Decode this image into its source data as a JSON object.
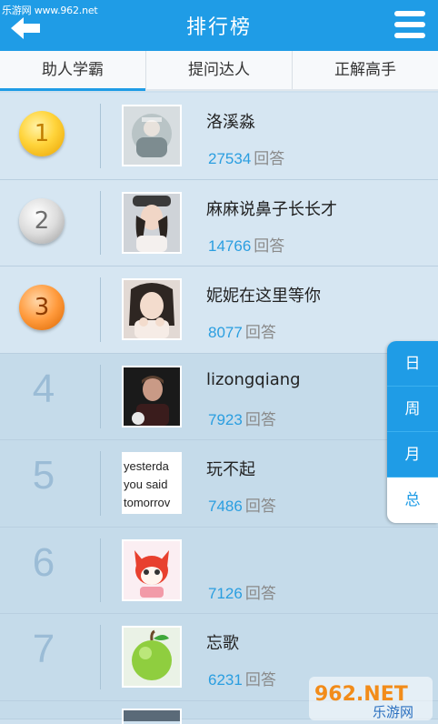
{
  "watermark_top": "乐游网 www.962.net",
  "header": {
    "title": "排行榜",
    "back_icon": "back-arrow-icon",
    "menu_icon": "menu-icon"
  },
  "tabs": [
    {
      "label": "助人学霸",
      "active": true
    },
    {
      "label": "提问达人",
      "active": false
    },
    {
      "label": "正解高手",
      "active": false
    }
  ],
  "answers_label": "回答",
  "rows": [
    {
      "rank": "1",
      "name": "洛溪淼",
      "count": "27534",
      "medal": "gold"
    },
    {
      "rank": "2",
      "name": "麻麻说鼻子长长才",
      "count": "14766",
      "medal": "silver"
    },
    {
      "rank": "3",
      "name": "妮妮在这里等你",
      "count": "8077",
      "medal": "bronze"
    },
    {
      "rank": "4",
      "name": "lizongqiang",
      "count": "7923"
    },
    {
      "rank": "5",
      "name": "玩不起",
      "count": "7486",
      "avatar_text": [
        "yesterda",
        "you said",
        "tomorrov"
      ]
    },
    {
      "rank": "6",
      "name": "",
      "count": "7126"
    },
    {
      "rank": "7",
      "name": "忘歌",
      "count": "6231"
    }
  ],
  "period_selector": [
    {
      "label": "日",
      "selected": false
    },
    {
      "label": "周",
      "selected": false
    },
    {
      "label": "月",
      "selected": false
    },
    {
      "label": "总",
      "selected": true
    }
  ],
  "watermark_logo": {
    "brand": "962.NET",
    "sub": "乐游网"
  },
  "colors": {
    "accent": "#1f9ce6",
    "count": "#2a9ee0"
  }
}
